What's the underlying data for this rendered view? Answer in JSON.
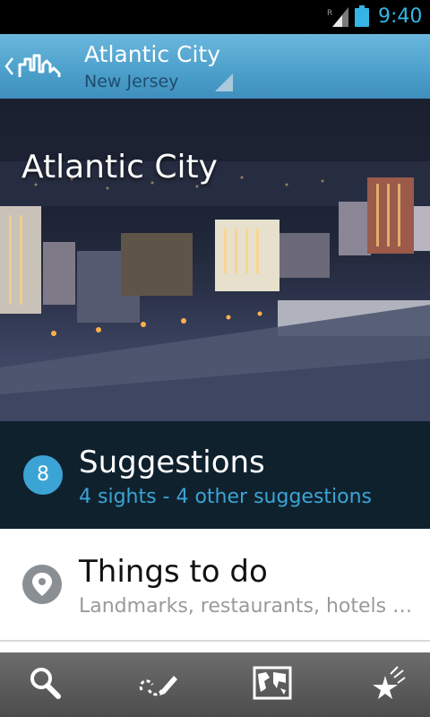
{
  "status_bar": {
    "time": "9:40",
    "signal_badge": "R",
    "icons": [
      "signal-icon",
      "battery-icon"
    ],
    "accent_color": "#35b5e5"
  },
  "action_bar": {
    "title": "Atlantic City",
    "subtitle": "New Jersey",
    "icons": [
      "back-chevron-icon",
      "city-skyline-logo-icon",
      "spinner-corner-icon"
    ]
  },
  "hero": {
    "title": "Atlantic City"
  },
  "suggestions": {
    "count": "8",
    "title": "Suggestions",
    "subtitle": "4 sights - 4 other suggestions"
  },
  "things_to_do": {
    "title": "Things to do",
    "subtitle": "Landmarks, restaurants, hotels …",
    "icon": "location-pin-icon"
  },
  "bottom_bar": {
    "items": [
      "search-icon",
      "route-pencil-icon",
      "map-icon",
      "favorites-stars-icon"
    ]
  },
  "colors": {
    "action_bar": "#4ea1cc",
    "suggestions_bg": "#10212e",
    "accent": "#3ba4d4",
    "bottom_bar": "#5a5a5a"
  }
}
